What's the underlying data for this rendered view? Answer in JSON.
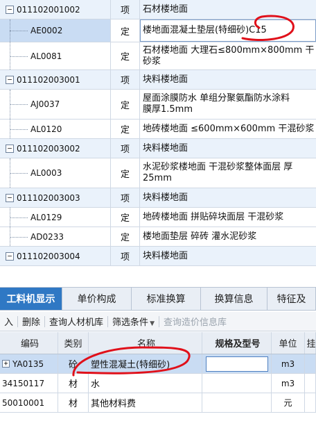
{
  "tree": {
    "rows": [
      {
        "code": "011102001002",
        "kind": "项",
        "desc": "石材楼地面",
        "parent": true
      },
      {
        "code": "AE0002",
        "kind": "定",
        "desc": "楼地面混凝土垫层(特细砂)C15",
        "parent": false,
        "selected": true
      },
      {
        "code": "AL0081",
        "kind": "定",
        "desc": "石材楼地面 大理石≤800mm×800mm 干\n砂浆",
        "parent": false
      },
      {
        "code": "011102003001",
        "kind": "项",
        "desc": "块料楼地面",
        "parent": true
      },
      {
        "code": "AJ0037",
        "kind": "定",
        "desc": "屋面涂膜防水 单组分聚氨酯防水涂料\n膜厚1.5mm",
        "parent": false
      },
      {
        "code": "AL0120",
        "kind": "定",
        "desc": "地砖楼地面 ≤600mm×600mm 干混砂浆",
        "parent": false
      },
      {
        "code": "011102003002",
        "kind": "项",
        "desc": "块料楼地面",
        "parent": true
      },
      {
        "code": "AL0003",
        "kind": "定",
        "desc": "水泥砂浆楼地面 干混砂浆整体面层 厚\n25mm",
        "parent": false
      },
      {
        "code": "011102003003",
        "kind": "项",
        "desc": "块料楼地面",
        "parent": true
      },
      {
        "code": "AL0129",
        "kind": "定",
        "desc": "地砖楼地面 拼贴碎块面层 干混砂浆",
        "parent": false
      },
      {
        "code": "AD0233",
        "kind": "定",
        "desc": "楼地面垫层 碎砖 灌水泥砂浆",
        "parent": false
      },
      {
        "code": "011102003004",
        "kind": "项",
        "desc": "块料楼地面",
        "parent": true
      }
    ]
  },
  "tabs": [
    "工料机显示",
    "单价构成",
    "标准换算",
    "换算信息",
    "特征及"
  ],
  "toolbar": {
    "insert": "入",
    "delete": "删除",
    "query_library": "查询人材机库",
    "filter": "筛选条件",
    "query_price": "查询造价信息库"
  },
  "bottom": {
    "headers": [
      "编码",
      "类别",
      "名称",
      "规格及型号",
      "单位",
      "挂"
    ],
    "rows": [
      {
        "code": "YA0135",
        "kind": "砼",
        "name": "塑性混凝土(特细砂)",
        "spec": "",
        "unit": "m3",
        "selected": true
      },
      {
        "code": "34150117",
        "kind": "材",
        "name": "水",
        "spec": "",
        "unit": "m3"
      },
      {
        "code": "50010001",
        "kind": "材",
        "name": "其他材料费",
        "spec": "",
        "unit": "元"
      }
    ]
  },
  "icons": {
    "expanded": "minus-box-icon",
    "collapsed": "plus-box-icon",
    "dropdown": "caret-down-icon"
  },
  "colors": {
    "active_tab": "#2f78c4",
    "selection": "#c9dcf3",
    "annotation": "#e0101a"
  }
}
